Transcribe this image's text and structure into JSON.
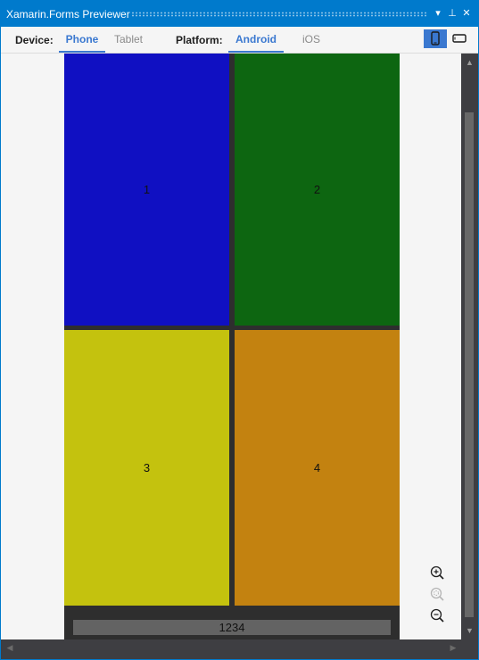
{
  "window": {
    "title": "Xamarin.Forms Previewer",
    "buttons": {
      "menu": "▾",
      "pin": "⊥",
      "close": "✕"
    }
  },
  "toolbar": {
    "device_label": "Device:",
    "device_tabs": [
      {
        "label": "Phone",
        "active": true
      },
      {
        "label": "Tablet",
        "active": false
      }
    ],
    "platform_label": "Platform:",
    "platform_tabs": [
      {
        "label": "Android",
        "active": true
      },
      {
        "label": "iOS",
        "active": false
      }
    ],
    "orientation": {
      "portrait_icon": "portrait-phone-icon",
      "landscape_icon": "landscape-phone-icon",
      "selected": "portrait"
    }
  },
  "preview": {
    "tiles": [
      {
        "label": "1",
        "color": "#1010c2"
      },
      {
        "label": "2",
        "color": "#0d6611"
      },
      {
        "label": "3",
        "color": "#c4c20e"
      },
      {
        "label": "4",
        "color": "#c38210"
      }
    ],
    "bottom_bar_text": "1234"
  },
  "zoom": {
    "zoom_in_icon": "zoom-in-icon",
    "zoom_reset_icon": "zoom-reset-icon",
    "zoom_out_icon": "zoom-out-icon"
  },
  "colors": {
    "accent": "#007acc",
    "tab_active": "#3a78d0",
    "device_background": "#2e2e2e"
  }
}
